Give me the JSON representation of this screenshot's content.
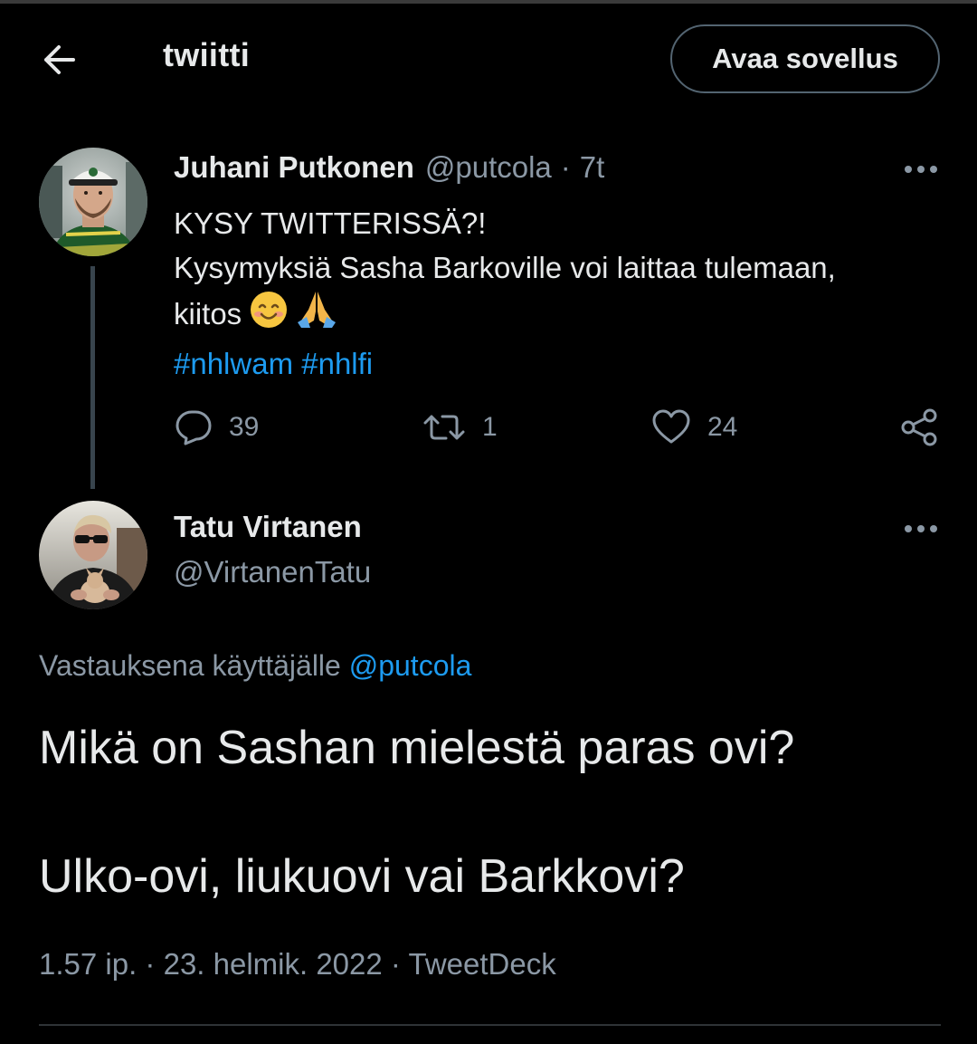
{
  "header": {
    "title": "twiitti",
    "open_app_label": "Avaa sovellus",
    "back_icon": "arrow-left-icon"
  },
  "tweet": {
    "author_name": "Juhani Putkonen",
    "author_handle": "@putcola",
    "separator": "·",
    "time": "7t",
    "lines": [
      "KYSY TWITTERISSÄ?!",
      "Kysymyksiä Sasha Barkoville voi laittaa tulemaan,",
      "kiitos"
    ],
    "emojis": [
      "smiling-face-icon",
      "folded-hands-icon"
    ],
    "hashtags": [
      "#nhlwam",
      "#nhlfi"
    ],
    "replies": "39",
    "retweets": "1",
    "likes": "24"
  },
  "reply": {
    "author_name": "Tatu Virtanen",
    "author_handle": "@VirtanenTatu",
    "reply_context_prefix": "Vastauksena käyttäjälle",
    "reply_context_mention": "@putcola",
    "text_line1": "Mikä on Sashan mielestä paras ovi?",
    "text_line2": "Ulko-ovi, liukuovi vai Barkkovi?",
    "time": "1.57 ip.",
    "separator": "·",
    "date": "23. helmik. 2022",
    "source": "TweetDeck"
  },
  "colors": {
    "background": "#000000",
    "text": "#e7e9ea",
    "muted": "#8b98a5",
    "accent": "#1d9bf0",
    "border": "#536471"
  }
}
